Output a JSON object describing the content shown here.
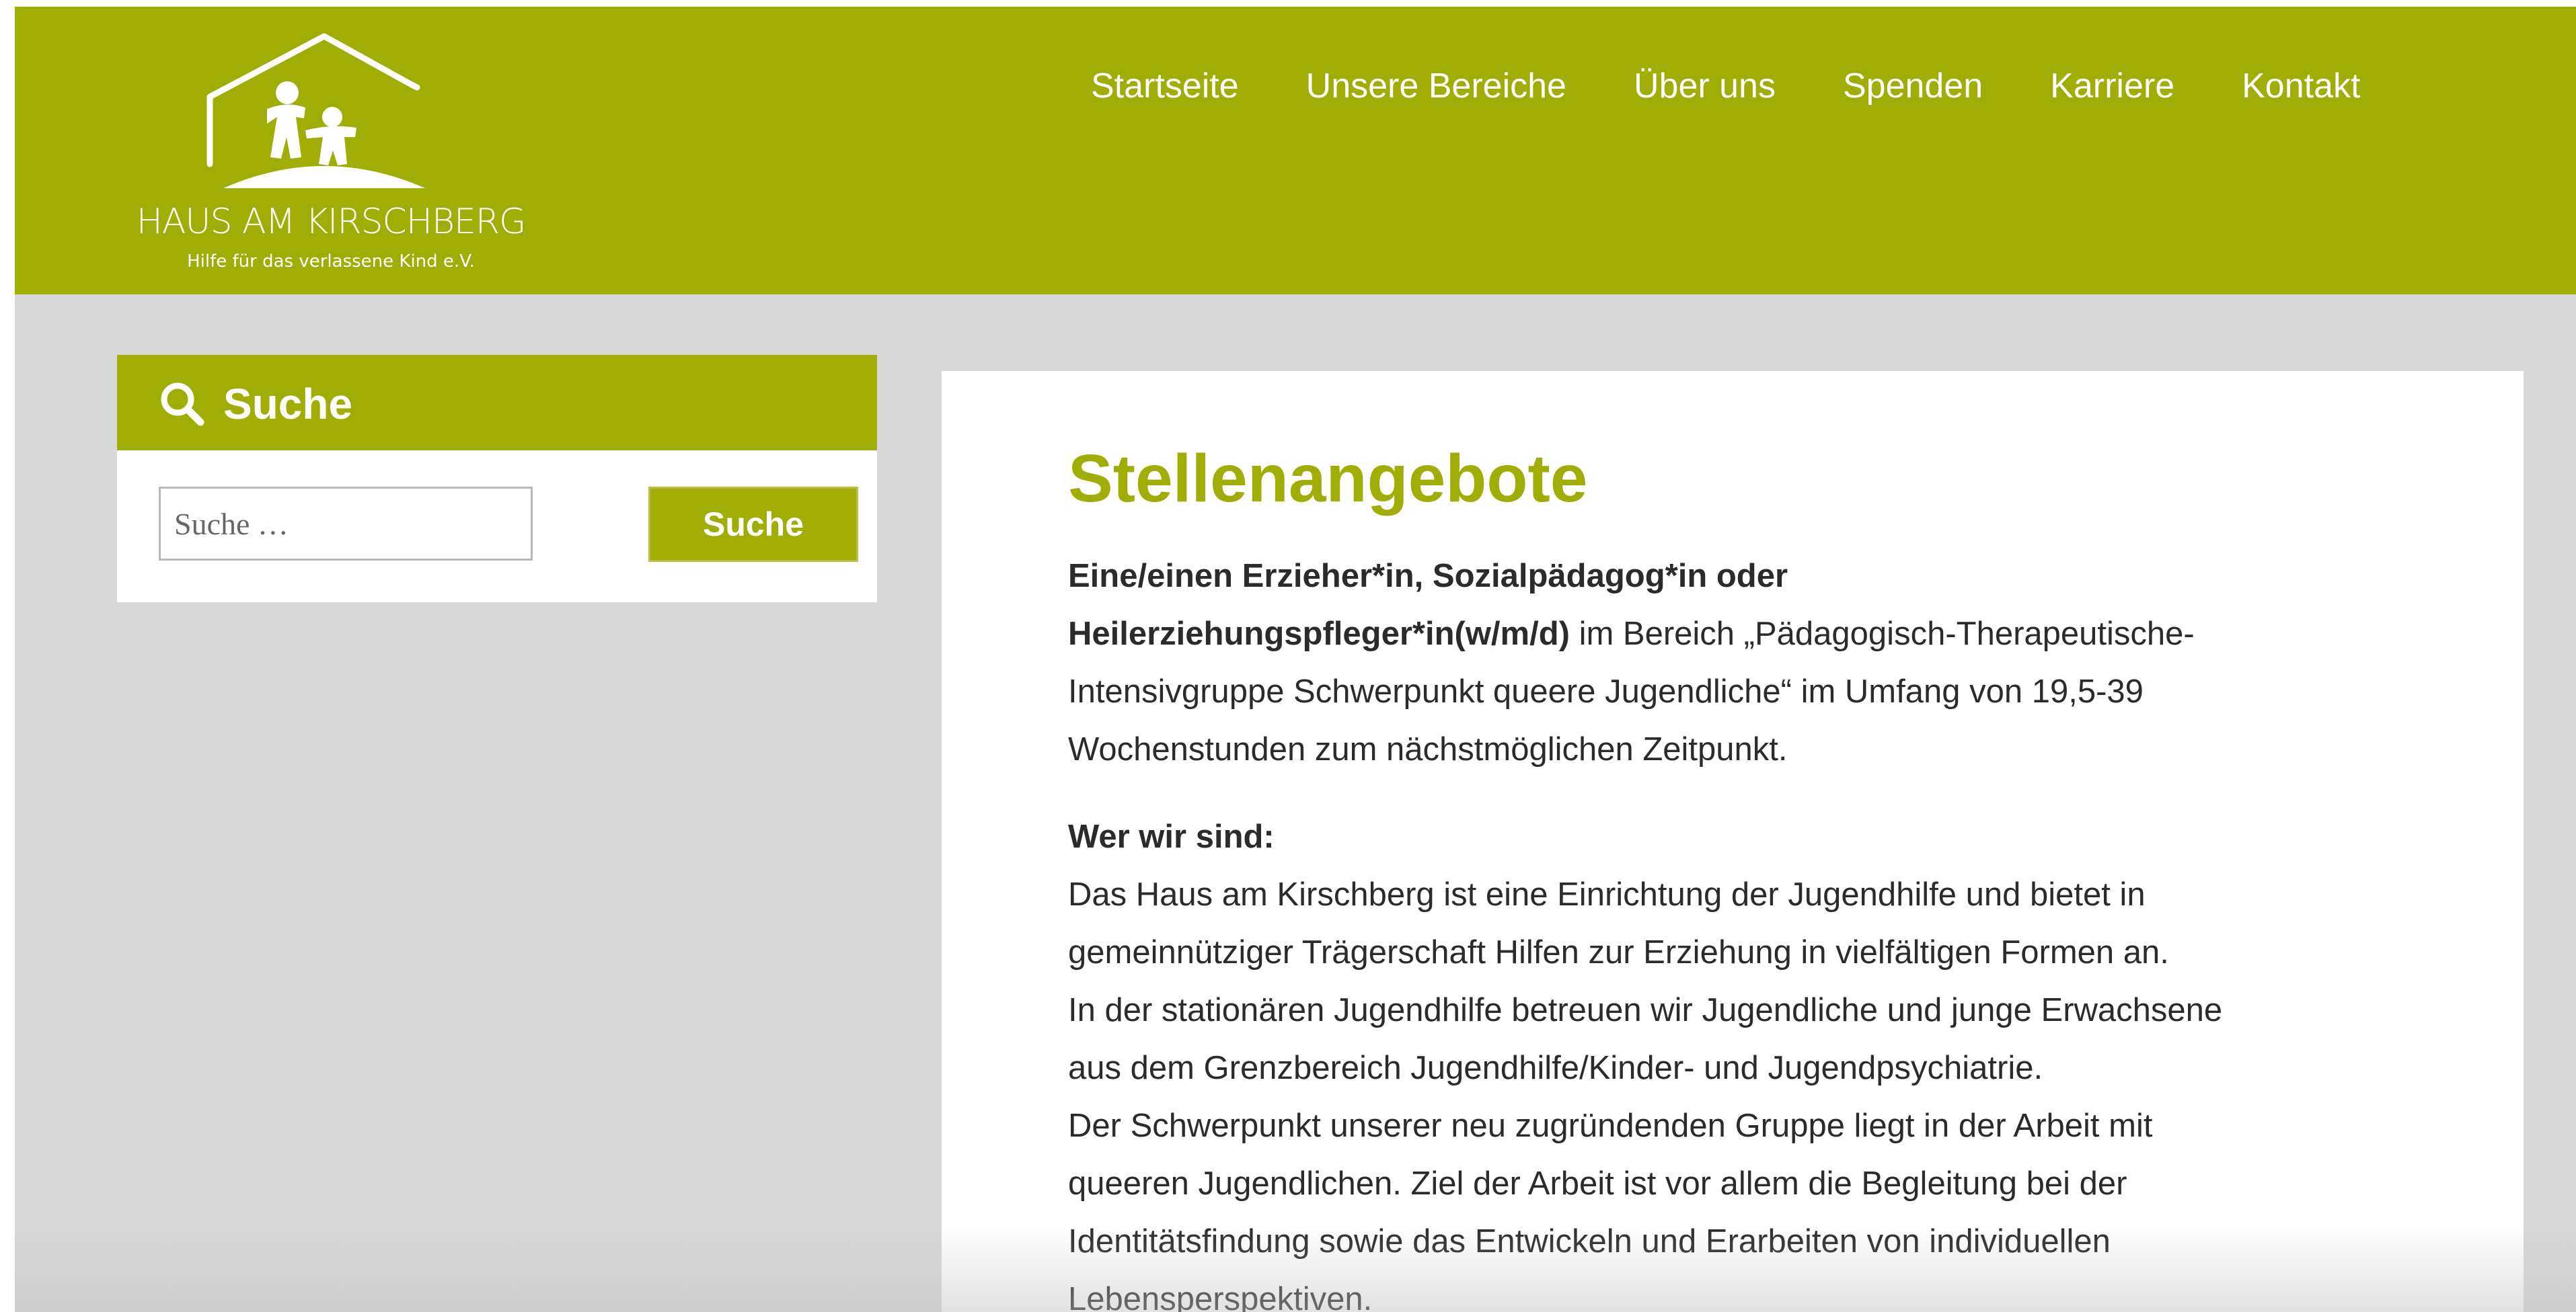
{
  "logo": {
    "name": "HAUS AM KIRSCHBERG",
    "subtitle": "Hilfe für das verlassene Kind e.V."
  },
  "nav": {
    "items": [
      "Startseite",
      "Unsere Bereiche",
      "Über uns",
      "Spenden",
      "Karriere",
      "Kontakt"
    ]
  },
  "sidebar": {
    "widget_title": "Suche",
    "search_placeholder": "Suche …",
    "search_button": "Suche"
  },
  "article": {
    "title": "Stellenangebote",
    "intro_bold_1": "Eine/einen Erzieher*in, Sozialpädagog*in oder",
    "intro_bold_2": "Heilerziehungspfleger*in(w/m/d)",
    "intro_rest_1": " im Bereich „Pädagogisch-Therapeutische-",
    "intro_line_3": "Intensivgruppe Schwerpunkt queere Jugendliche“ im Umfang von 19,5-39",
    "intro_line_4": "Wochenstunden zum nächstmöglichen Zeitpunkt.",
    "section_heading": "Wer wir sind:",
    "lines": [
      "Das Haus am Kirschberg ist eine Einrichtung der Jugendhilfe und bietet in",
      "gemeinnütziger Trägerschaft Hilfen zur Erziehung in vielfältigen Formen an.",
      "In der stationären Jugendhilfe betreuen wir Jugendliche und junge Erwachsene",
      "aus dem Grenzbereich Jugendhilfe/Kinder- und Jugendpsychiatrie.",
      "Der Schwerpunkt unserer neu zugründenden Gruppe liegt in der Arbeit mit",
      "queeren Jugendlichen. Ziel der Arbeit ist vor allem die Begleitung bei der",
      "Identitätsfindung sowie das Entwickeln und Erarbeiten von individuellen",
      "Lebensperspektiven."
    ]
  },
  "colors": {
    "brand_green": "#a0ad04",
    "page_background": "#d8d8d8"
  },
  "icons": {
    "logo": "house-with-children-icon",
    "search": "search-icon"
  }
}
